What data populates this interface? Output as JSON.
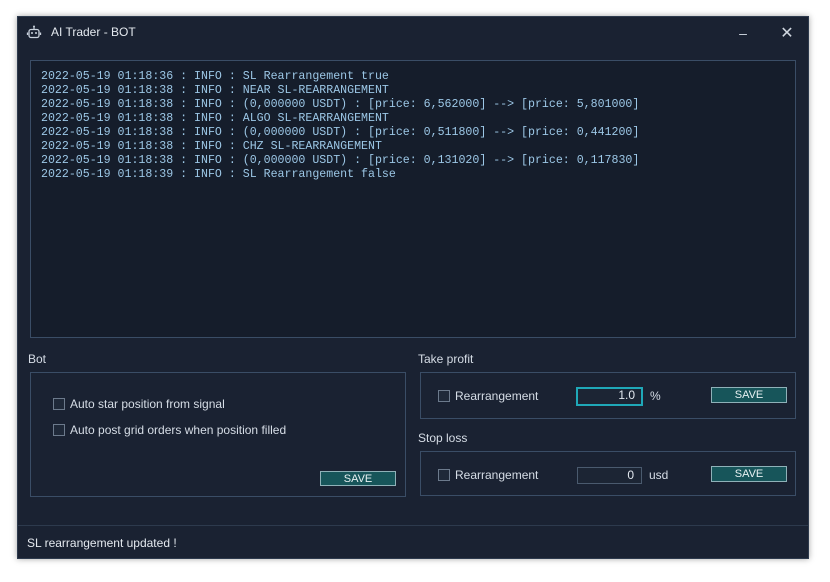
{
  "window": {
    "title": "AI Trader - BOT",
    "minimize_glyph": "–",
    "close_glyph": "✕"
  },
  "log": {
    "lines": [
      "2022-05-19 01:18:36 : INFO : SL Rearrangement true",
      "2022-05-19 01:18:38 : INFO : NEAR SL-REARRANGEMENT",
      "2022-05-19 01:18:38 : INFO : (0,000000 USDT) : [price: 6,562000] --> [price: 5,801000]",
      "2022-05-19 01:18:38 : INFO : ALGO SL-REARRANGEMENT",
      "2022-05-19 01:18:38 : INFO : (0,000000 USDT) : [price: 0,511800] --> [price: 0,441200]",
      "2022-05-19 01:18:38 : INFO : CHZ SL-REARRANGEMENT",
      "2022-05-19 01:18:38 : INFO : (0,000000 USDT) : [price: 0,131020] --> [price: 0,117830]",
      "2022-05-19 01:18:39 : INFO : SL Rearrangement false"
    ]
  },
  "bot": {
    "label": "Bot",
    "auto_star_label": "Auto star position from signal",
    "auto_star_checked": false,
    "auto_post_label": "Auto post grid orders when position filled",
    "auto_post_checked": false,
    "save_label": "SAVE"
  },
  "take_profit": {
    "label": "Take profit",
    "rearrangement_label": "Rearrangement",
    "rearrangement_checked": false,
    "value": "1.0",
    "unit": "%",
    "save_label": "SAVE"
  },
  "stop_loss": {
    "label": "Stop loss",
    "rearrangement_label": "Rearrangement",
    "rearrangement_checked": false,
    "value": "0",
    "unit": "usd",
    "save_label": "SAVE"
  },
  "status": {
    "text": "SL rearrangement updated !"
  },
  "icons": {
    "app": "robot-icon"
  },
  "colors": {
    "background": "#1a2232",
    "log_text": "#9cc7e6",
    "button": "#17555a",
    "focus": "#1fa8b8"
  }
}
